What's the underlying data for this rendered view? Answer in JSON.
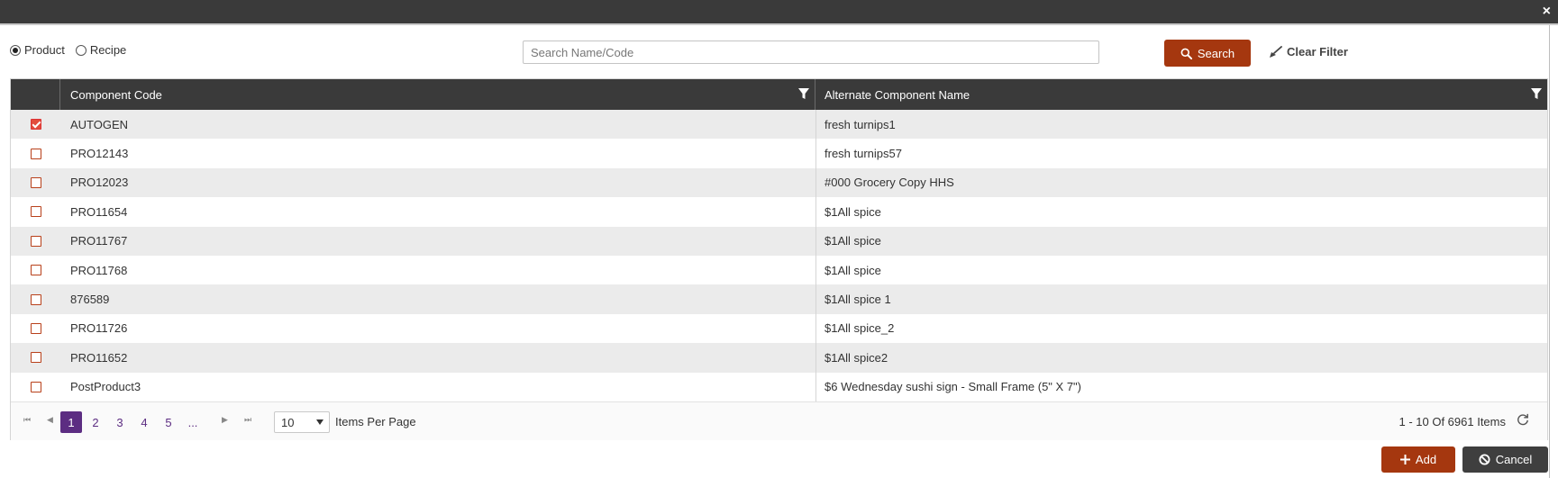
{
  "window": {
    "close_glyph": "×"
  },
  "filter_type": {
    "options": [
      {
        "label": "Product",
        "selected": true
      },
      {
        "label": "Recipe",
        "selected": false
      }
    ]
  },
  "search": {
    "value": "",
    "placeholder": "Search Name/Code",
    "button_label": "Search",
    "clear_label": "Clear Filter"
  },
  "grid": {
    "columns": [
      "Component Code",
      "Alternate Component Name"
    ],
    "rows": [
      {
        "checked": true,
        "code": "AUTOGEN",
        "name": "fresh turnips1"
      },
      {
        "checked": false,
        "code": "PRO12143",
        "name": "fresh turnips57"
      },
      {
        "checked": false,
        "code": "PRO12023",
        "name": "#000 Grocery Copy HHS"
      },
      {
        "checked": false,
        "code": "PRO11654",
        "name": "$1All spice"
      },
      {
        "checked": false,
        "code": "PRO11767",
        "name": "$1All spice"
      },
      {
        "checked": false,
        "code": "PRO11768",
        "name": "$1All spice"
      },
      {
        "checked": false,
        "code": "876589",
        "name": "$1All spice 1"
      },
      {
        "checked": false,
        "code": "PRO11726",
        "name": "$1All spice_2"
      },
      {
        "checked": false,
        "code": "PRO11652",
        "name": "$1All spice2"
      },
      {
        "checked": false,
        "code": "PostProduct3",
        "name": "$6 Wednesday sushi sign - Small Frame (5\" X 7\")"
      }
    ]
  },
  "pager": {
    "pages": [
      "1",
      "2",
      "3",
      "4",
      "5",
      "..."
    ],
    "current_page": "1",
    "page_size": "10",
    "per_page_label": "Items Per Page",
    "info": "1 - 10 Of 6961 Items"
  },
  "actions": {
    "add_label": "Add",
    "cancel_label": "Cancel"
  },
  "colors": {
    "accent": "#a5370f",
    "header": "#3a3a3a",
    "pager_active": "#5c2d82",
    "checkbox_checked": "#e24c3d"
  }
}
